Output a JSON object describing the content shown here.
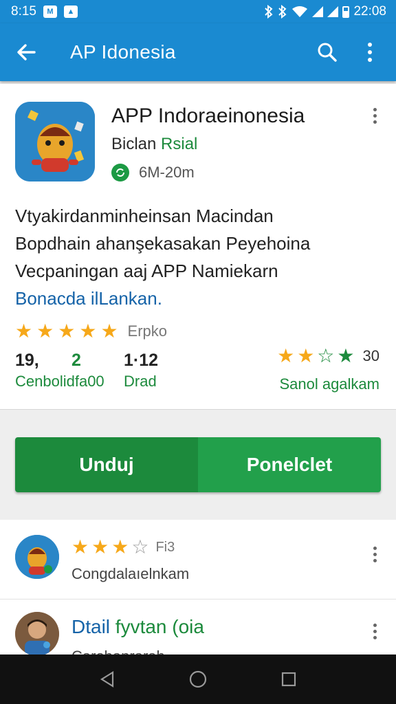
{
  "status_bar": {
    "time_left": "8:15",
    "time_right": "22:08",
    "mini_icon_1": "M",
    "mini_icon_2": "▲"
  },
  "app_bar": {
    "title": "AP Idonesia",
    "back_icon": "arrow-left-icon",
    "search_icon": "search-icon",
    "more_icon": "more-vert-icon"
  },
  "app": {
    "name": "APP Indoraeinonesia",
    "developer_prefix": "Biclan ",
    "developer_green": "Rsial",
    "size": "6M-20m",
    "description_lines": [
      "Vtyakirdanminheinsan Macindan",
      "Bopdhain ahanşekasakan Peyehoina",
      "Vecpaningan aaj APP Namiekarn"
    ],
    "description_link": "Bonacda ilLankan.",
    "rating_stars": 5,
    "rating_label": "Erpko",
    "stat1_value": "19,",
    "stat2_value": "2",
    "stat3_value": "1·12",
    "stats_sub_left": "Cenbolidfa00",
    "stats_sub_right": "Drad",
    "right_stars_filled": 2,
    "right_count": "30",
    "right_label": "Sanol agalkam"
  },
  "buttons": {
    "primary": "Unduj",
    "secondary": "Ponelclet"
  },
  "list": {
    "item1_stars": 3,
    "item1_count": "Fi3",
    "item1_sub": "Congdalaıelnkam",
    "item2_title_blue": "Dtail ",
    "item2_title_green": "fyvtan",
    "item2_title_blue2": " (oia",
    "item2_sub": "Carobanrarah"
  },
  "colors": {
    "primary_blue": "#1a8ad1",
    "green": "#1c8a3c",
    "star": "#f6a81a"
  }
}
